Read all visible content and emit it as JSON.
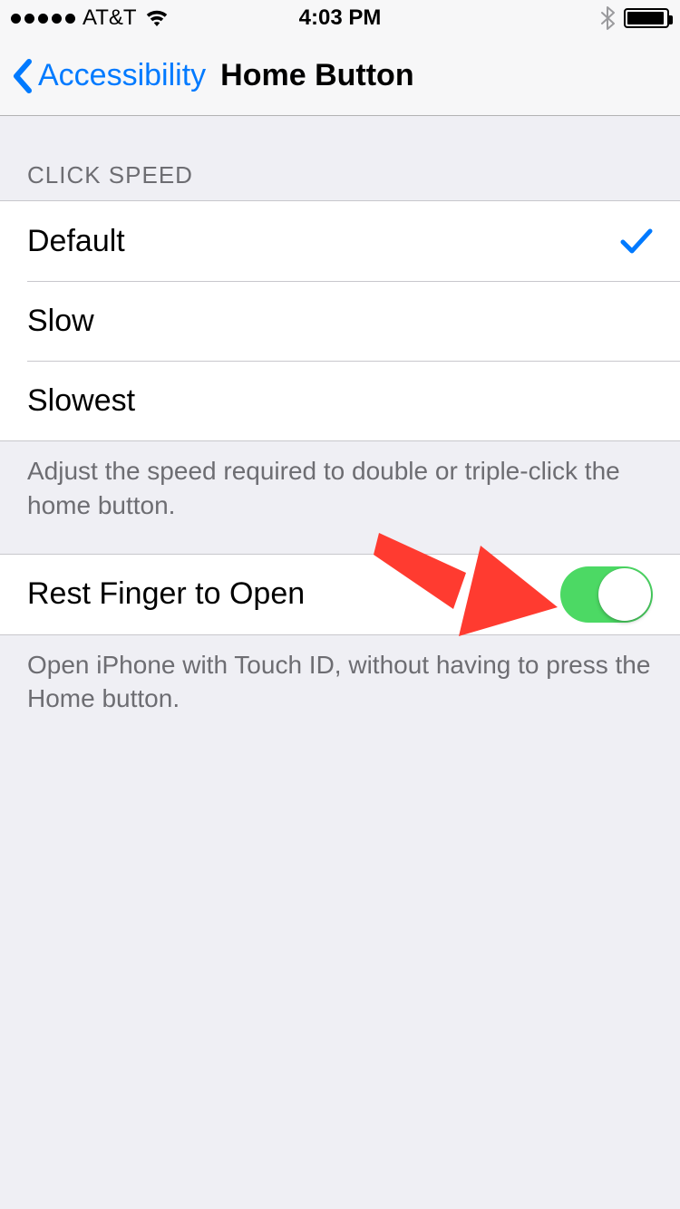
{
  "status": {
    "carrier": "AT&T",
    "time": "4:03 PM"
  },
  "nav": {
    "back_label": "Accessibility",
    "title": "Home Button"
  },
  "sections": {
    "click_speed": {
      "header": "CLICK SPEED",
      "options": [
        {
          "label": "Default",
          "selected": true
        },
        {
          "label": "Slow",
          "selected": false
        },
        {
          "label": "Slowest",
          "selected": false
        }
      ],
      "footer": "Adjust the speed required to double or triple-click the home button."
    },
    "rest_finger": {
      "label": "Rest Finger to Open",
      "enabled": true,
      "footer": "Open iPhone with Touch ID, without having to press the Home button."
    }
  },
  "colors": {
    "tint": "#007aff",
    "switch_on": "#4cd964",
    "annotation_arrow": "#ff3b30"
  }
}
